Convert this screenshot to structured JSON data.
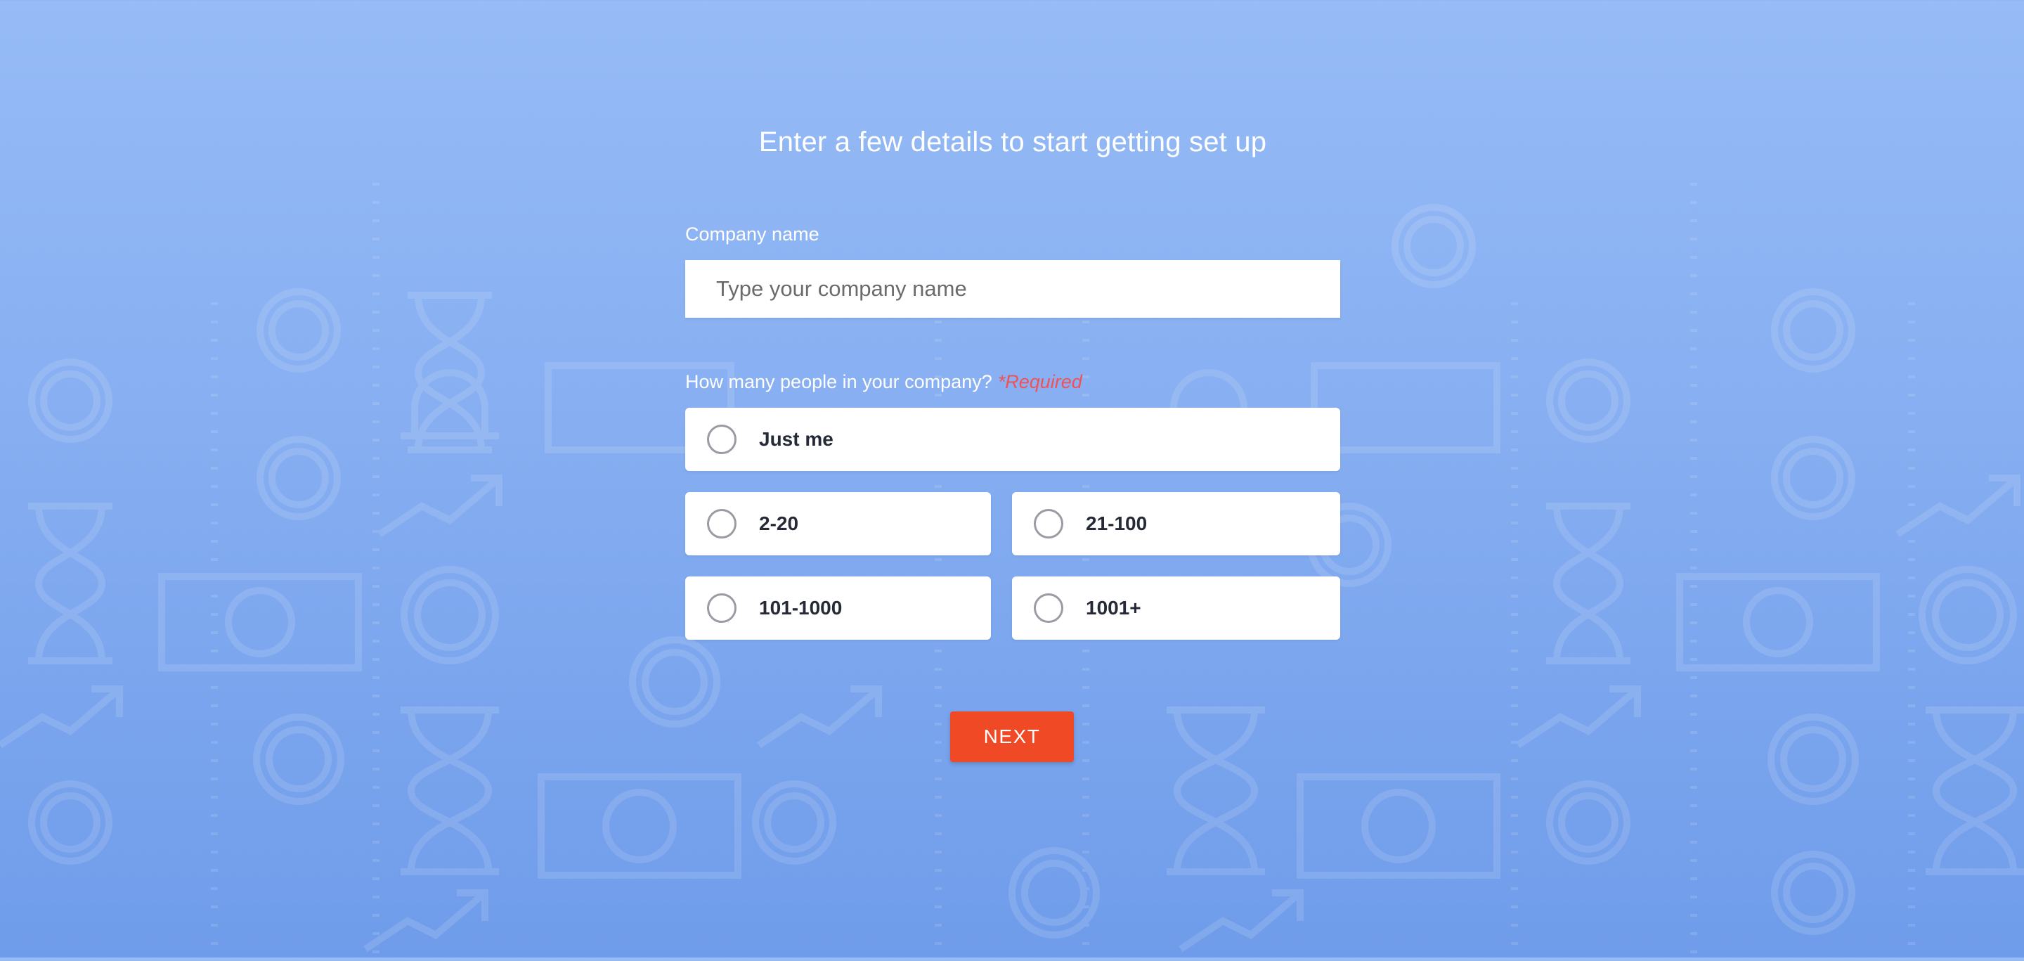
{
  "page": {
    "title": "Enter a few details to start getting set up"
  },
  "company": {
    "label": "Company name",
    "placeholder": "Type your company name",
    "value": ""
  },
  "size_question": {
    "label": "How many people in your company?",
    "required": "*Required",
    "options": [
      {
        "label": "Just me",
        "selected": false
      },
      {
        "label": "2-20",
        "selected": false
      },
      {
        "label": "21-100",
        "selected": false
      },
      {
        "label": "101-1000",
        "selected": false
      },
      {
        "label": "1001+",
        "selected": false
      }
    ]
  },
  "actions": {
    "next_label": "NEXT"
  },
  "colors": {
    "background_top": "#96bbf6",
    "background_bottom": "#6f9cea",
    "accent": "#ef4a25",
    "required": "#f0525a"
  },
  "background_icons": [
    "dollar-coin-icon",
    "banknote-icon",
    "hourglass-icon",
    "trend-up-icon",
    "bell-icon"
  ]
}
